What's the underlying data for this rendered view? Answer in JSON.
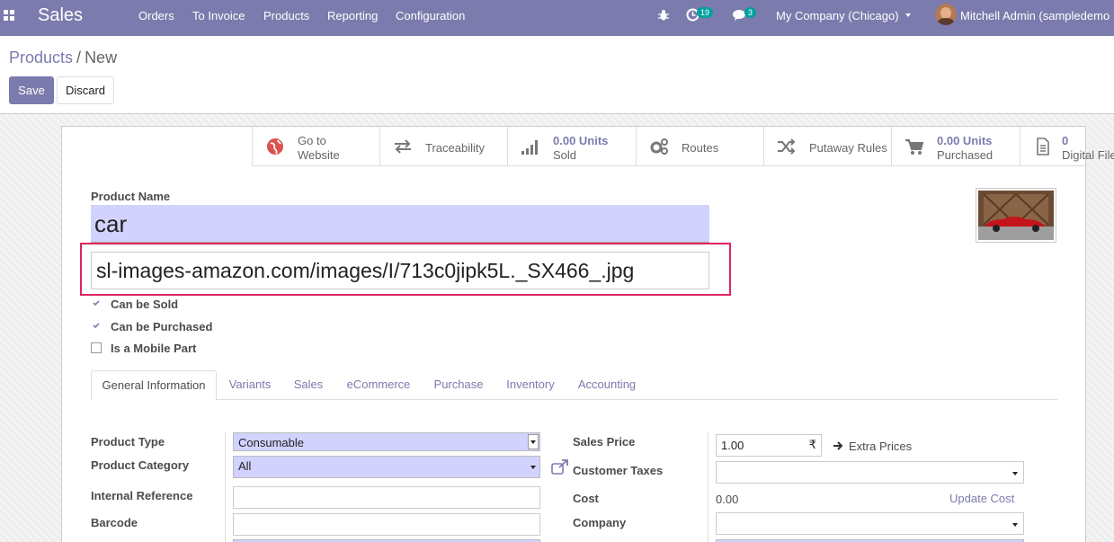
{
  "navbar": {
    "app_name": "Sales",
    "menu": [
      "Orders",
      "To Invoice",
      "Products",
      "Reporting",
      "Configuration"
    ],
    "activity_count": "19",
    "messages_count": "3",
    "company": "My Company (Chicago)",
    "user": "Mitchell Admin (sampledemo"
  },
  "breadcrumb": {
    "parent": "Products",
    "separator": "/",
    "current": "New"
  },
  "buttons": {
    "save": "Save",
    "discard": "Discard"
  },
  "stat_buttons": {
    "website": {
      "line1": "Go to",
      "line2": "Website",
      "icon": "globe-icon"
    },
    "traceability": {
      "label": "Traceability",
      "icon": "exchange-icon"
    },
    "sold": {
      "value": "0.00 Units",
      "label": "Sold",
      "icon": "signal-icon"
    },
    "routes": {
      "label": "Routes",
      "icon": "cogs-icon"
    },
    "putaway": {
      "label": "Putaway Rules",
      "icon": "random-icon"
    },
    "purchased": {
      "value": "0.00 Units",
      "label": "Purchased",
      "icon": "cart-icon"
    },
    "digital": {
      "value": "0",
      "label": "Digital Files",
      "icon": "file-icon"
    }
  },
  "form": {
    "product_name_label": "Product Name",
    "product_name": "car",
    "image_url": "sl-images-amazon.com/images/I/713c0jipk5L._SX466_.jpg",
    "can_be_sold": "Can be Sold",
    "can_be_purchased": "Can be Purchased",
    "is_mobile_part": "Is a Mobile Part",
    "checks": {
      "sold": true,
      "purchased": true,
      "mobile": false
    }
  },
  "tabs": [
    "General Information",
    "Variants",
    "Sales",
    "eCommerce",
    "Purchase",
    "Inventory",
    "Accounting"
  ],
  "general": {
    "product_type_label": "Product Type",
    "product_type": "Consumable",
    "product_category_label": "Product Category",
    "product_category": "All",
    "internal_ref_label": "Internal Reference",
    "internal_ref": "",
    "barcode_label": "Barcode",
    "barcode": "",
    "sales_price_label": "Sales Price",
    "sales_price": "1.00",
    "currency": "₹",
    "extra_prices": "Extra Prices",
    "customer_taxes_label": "Customer Taxes",
    "customer_taxes": "",
    "cost_label": "Cost",
    "cost": "0.00",
    "update_cost": "Update Cost",
    "company_label": "Company",
    "company": ""
  },
  "colors": {
    "brand": "#7c7bad",
    "badge": "#00a09d",
    "required": "#d2d2ff",
    "highlight": "#e0245e"
  }
}
